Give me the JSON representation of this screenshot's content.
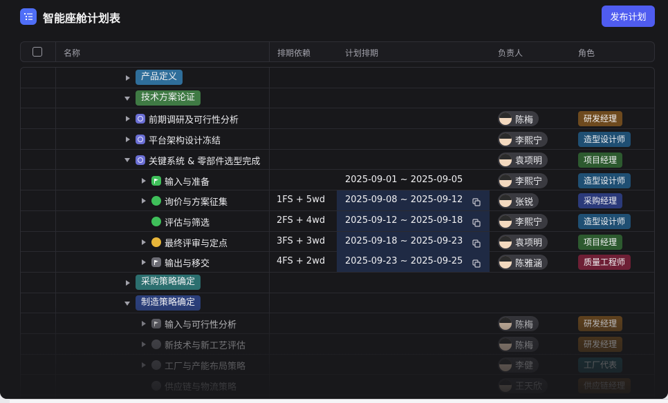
{
  "app": {
    "title": "智能座舱计划表",
    "publish_label": "发布计划"
  },
  "columns": {
    "name": "名称",
    "dependency": "排期依赖",
    "schedule": "计划排期",
    "owner": "负责人",
    "role": "角色"
  },
  "colors": {
    "accent": "#4f5cf0"
  },
  "rows": [
    {
      "kind": "group",
      "label": "产品定义",
      "expanded": false,
      "color": "#2f6e9a"
    },
    {
      "kind": "group",
      "label": "技术方案论证",
      "expanded": true,
      "color": "#3f7a44"
    },
    {
      "kind": "task",
      "level": 1,
      "arrow": "right",
      "status": "milestone",
      "name": "前期调研及可行性分析",
      "dep": "",
      "plan": "",
      "owner": "陈梅",
      "role": "研发经理",
      "role_color": "#6e4a1e"
    },
    {
      "kind": "task",
      "level": 1,
      "arrow": "right",
      "status": "milestone",
      "name": "平台架构设计冻结",
      "dep": "",
      "plan": "",
      "owner": "李熙宁",
      "role": "造型设计师",
      "role_color": "#1f4f73"
    },
    {
      "kind": "task",
      "level": 1,
      "arrow": "down",
      "status": "milestone",
      "name": "关键系统 & 零部件选型完成",
      "dep": "",
      "plan": "",
      "owner": "袁项明",
      "role": "项目经理",
      "role_color": "#2d5a2f"
    },
    {
      "kind": "task",
      "level": 2,
      "arrow": "right",
      "status": "flag",
      "name": "输入与准备",
      "dep": "",
      "plan": "2025-09-01 ~ 2025-09-05",
      "highlight": false,
      "owner": "李熙宁",
      "role": "造型设计师",
      "role_color": "#1f4f73"
    },
    {
      "kind": "task",
      "level": 2,
      "arrow": "right",
      "status": "green",
      "name": "询价与方案征集",
      "dep": "1FS + 5wd",
      "plan": "2025-09-08 ~ 2025-09-12",
      "highlight": true,
      "owner": "张锐",
      "role": "采购经理",
      "role_color": "#2b3a7a"
    },
    {
      "kind": "task",
      "level": 2,
      "arrow": "",
      "status": "green",
      "name": "评估与筛选",
      "dep": "2FS + 4wd",
      "plan": "2025-09-12 ~ 2025-09-18",
      "highlight": true,
      "owner": "李熙宁",
      "role": "造型设计师",
      "role_color": "#1f4f73"
    },
    {
      "kind": "task",
      "level": 2,
      "arrow": "right",
      "status": "yellow",
      "name": "最终评审与定点",
      "dep": "3FS + 3wd",
      "plan": "2025-09-18 ~ 2025-09-23",
      "highlight": true,
      "owner": "袁项明",
      "role": "项目经理",
      "role_color": "#2d5a2f"
    },
    {
      "kind": "task",
      "level": 2,
      "arrow": "right",
      "status": "flag-gray",
      "name": "输出与移交",
      "dep": "4FS + 2wd",
      "plan": "2025-09-23 ~ 2025-09-25",
      "highlight": true,
      "owner": "陈雅涵",
      "role": "质量工程师",
      "role_color": "#6e1f35"
    },
    {
      "kind": "group",
      "label": "采购策略确定",
      "expanded": false,
      "color": "#2c6f6f"
    },
    {
      "kind": "group",
      "label": "制造策略确定",
      "expanded": true,
      "color": "#2b3f7a"
    },
    {
      "kind": "task",
      "level": 2,
      "arrow": "right",
      "status": "flag-gray",
      "name": "输入与可行性分析",
      "dep": "",
      "plan": "",
      "owner": "陈梅",
      "role": "研发经理",
      "role_color": "#6e4a1e"
    },
    {
      "kind": "task",
      "level": 2,
      "arrow": "right",
      "status": "gray",
      "name": "新技术与新工艺评估",
      "dep": "",
      "plan": "",
      "owner": "陈梅",
      "role": "研发经理",
      "role_color": "#6e4a1e"
    },
    {
      "kind": "task",
      "level": 2,
      "arrow": "right",
      "status": "gray",
      "name": "工厂与产能布局策略",
      "dep": "",
      "plan": "",
      "owner": "李健",
      "role": "工厂代表",
      "role_color": "#1f4f5a"
    },
    {
      "kind": "task",
      "level": 2,
      "arrow": "",
      "status": "gray",
      "name": "供应链与物流策略",
      "dep": "",
      "plan": "",
      "owner": "王天欣",
      "role": "供应链经理",
      "role_color": "#6e4a1e"
    }
  ]
}
